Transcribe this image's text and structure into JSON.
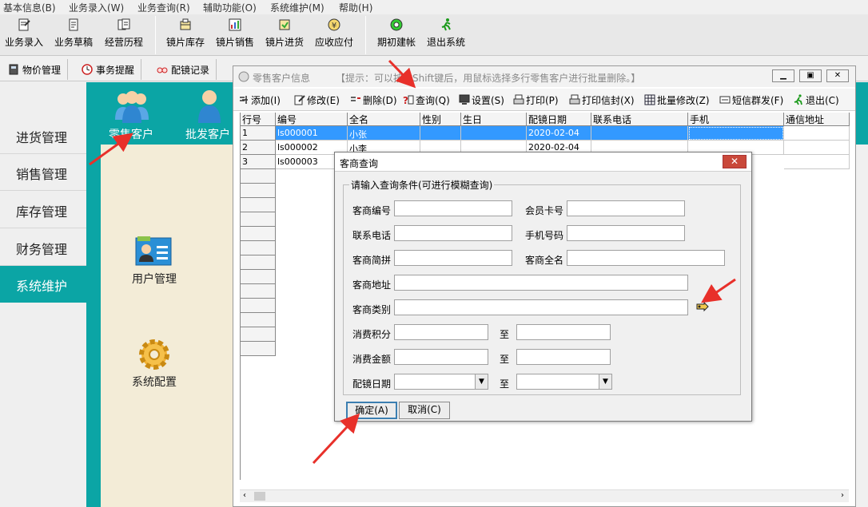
{
  "menubar": [
    "基本信息(B)",
    "业务录入(W)",
    "业务查询(R)",
    "辅助功能(O)",
    "系统维护(M)",
    "帮助(H)"
  ],
  "toolbar": [
    "业务录入",
    "业务草稿",
    "经营历程",
    "镜片库存",
    "镜片销售",
    "镜片进货",
    "应收应付",
    "期初建帐",
    "退出系统"
  ],
  "tabs": [
    "物价管理",
    "事务提醒",
    "配镜记录"
  ],
  "leftnav": [
    "进货管理",
    "销售管理",
    "库存管理",
    "财务管理",
    "系统维护"
  ],
  "modules": {
    "retail_customer": "零售客户",
    "wholesale_customer": "批发客户",
    "user_management": "用户管理",
    "system_config": "系统配置"
  },
  "child_window": {
    "title": "零售客户信息",
    "hint": "【提示：可以按住Shift键后，用鼠标选择多行零售客户进行批量删除。】",
    "toolbar": [
      "添加(I)",
      "修改(E)",
      "删除(D)",
      "查询(Q)",
      "设置(S)",
      "打印(P)",
      "打印信封(X)",
      "批量修改(Z)",
      "短信群发(F)",
      "退出(C)"
    ],
    "columns": [
      "行号",
      "编号",
      "全名",
      "性别",
      "生日",
      "配镜日期",
      "联系电话",
      "手机",
      "通信地址"
    ],
    "rows": [
      {
        "row": "1",
        "code": "ls000001",
        "name": "小张",
        "sex": "",
        "birthday": "",
        "date": "2020-02-04",
        "phone": "",
        "mobile": "",
        "address": ""
      },
      {
        "row": "2",
        "code": "ls000002",
        "name": "小李",
        "sex": "",
        "birthday": "",
        "date": "2020-02-04",
        "phone": "",
        "mobile": "",
        "address": ""
      },
      {
        "row": "3",
        "code": "ls000003",
        "name": "",
        "sex": "",
        "birthday": "",
        "date": "",
        "phone": "",
        "mobile": "",
        "address": ""
      }
    ]
  },
  "dialog": {
    "title": "客商查询",
    "close": "✕",
    "group_label": "请输入查询条件(可进行模糊查询)",
    "labels": {
      "code": "客商编号",
      "member_card": "会员卡号",
      "phone": "联系电话",
      "mobile": "手机号码",
      "pinyin": "客商简拼",
      "fullname": "客商全名",
      "address": "客商地址",
      "category": "客商类别",
      "points": "消费积分",
      "amount": "消费金额",
      "date": "配镜日期",
      "to": "至"
    },
    "ok": "确定(A)",
    "cancel": "取消(C)"
  },
  "colors": {
    "teal": "#0ba5a5",
    "selection": "#3399ff",
    "arrow": "#e8302a",
    "content_bg": "#f3ecd7"
  }
}
